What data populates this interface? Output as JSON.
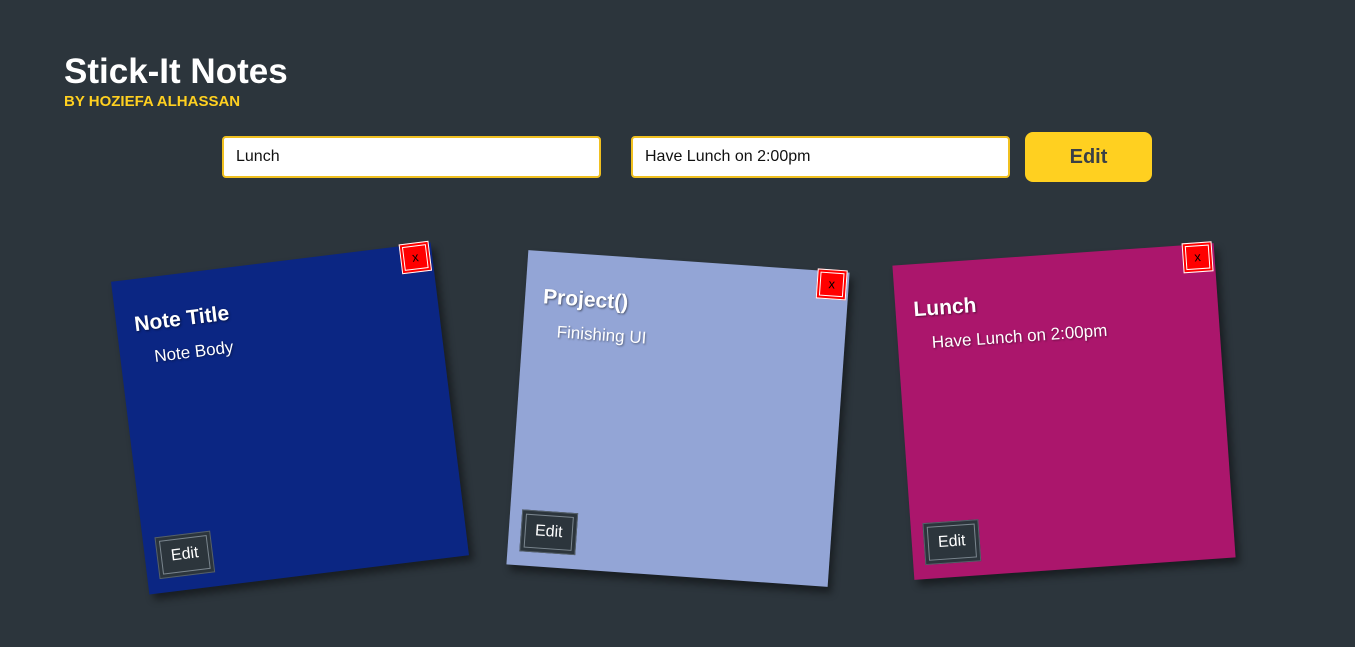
{
  "header": {
    "title": "Stick-It Notes",
    "byline": "BY HOZIEFA ALHASSAN"
  },
  "form": {
    "title_value": "Lunch",
    "body_value": "Have Lunch on 2:00pm",
    "submit_label": "Edit"
  },
  "notes": [
    {
      "title": "Note Title",
      "body": "Note Body",
      "color": "#0b2683",
      "close_label": "x",
      "edit_label": "Edit"
    },
    {
      "title": "Project()",
      "body": "Finishing UI",
      "color": "#93a5d6",
      "close_label": "x",
      "edit_label": "Edit"
    },
    {
      "title": "Lunch",
      "body": "Have Lunch on 2:00pm",
      "color": "#ab166c",
      "close_label": "x",
      "edit_label": "Edit"
    }
  ],
  "colors": {
    "background": "#2c353c",
    "accent": "#ffd020",
    "close": "#ff0000"
  }
}
